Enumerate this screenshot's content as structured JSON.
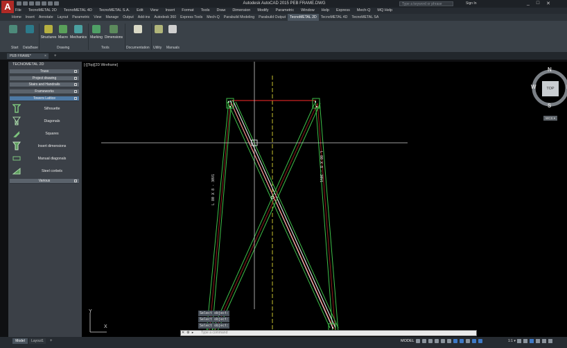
{
  "window": {
    "title": "Autodesk AutoCAD 2015    PEB FRAME.DWG",
    "search_placeholder": "Type a keyword or phrase",
    "sign_in": "Sign In",
    "controls": [
      "_",
      "□",
      "✕"
    ]
  },
  "menu": [
    "File",
    "TecnoMETAL 2D",
    "TecnoMETAL 4D",
    "TecnoMETAL S.A.",
    "Edit",
    "View",
    "Insert",
    "Format",
    "Tools",
    "Draw",
    "Dimension",
    "Modify",
    "Parametric",
    "Window",
    "Help",
    "Express",
    "Mech-Q",
    "MQ Help"
  ],
  "ribbon_tabs": [
    "Home",
    "Insert",
    "Annotate",
    "Layout",
    "Parametric",
    "View",
    "Manage",
    "Output",
    "Add-ins",
    "Autodesk 360",
    "Express Tools",
    "Mech-Q",
    "Parabuild Modeling",
    "Parabuild Output",
    "TecnoMETAL 2D",
    "TecnoMETAL 4D",
    "TecnoMETAL SA"
  ],
  "ribbon_active_tab": "TecnoMETAL 2D",
  "ribbon": {
    "buttons": [
      "Structures",
      "Macro",
      "Mechanics",
      "Marking",
      "Dimensions",
      "Utility"
    ],
    "groups": [
      "Start",
      "DataBase",
      "Drawing",
      "Tools",
      "Documentation",
      "Utility",
      "Manuals"
    ]
  },
  "file_tab": {
    "label": "PEB FRAME*",
    "close": "×",
    "new": "+"
  },
  "palette": {
    "title": "TECNOMETAL 2D",
    "categories": [
      "Truss",
      "Project drawing",
      "Stairs and Handrails",
      "Frameworks",
      "Towers Lattice"
    ],
    "items": [
      "Silhouette",
      "Diagonals",
      "Squares",
      "Insert dimensions",
      "Manual diagonals",
      "Steel corbels"
    ],
    "bottom_category": "Various"
  },
  "viewport": {
    "label": "[-][Top][2D Wireframe]",
    "member_label_left": "L 80 X 8 - 30V1",
    "member_label_right": "L 80 X 8 - 30V1"
  },
  "viewcube": {
    "top": "TOP",
    "n": "N",
    "s": "S",
    "w": "W",
    "e": "E",
    "wcs": "WCS ▾"
  },
  "ucs": {
    "y": "Y",
    "x": "X"
  },
  "command": {
    "history": [
      "Select object:",
      "Select object:",
      "Select object:"
    ],
    "placeholder": "Type a command"
  },
  "status": {
    "tabs": [
      "Model",
      "Layout1"
    ],
    "add_tab": "+",
    "model": "MODEL",
    "scale": "1:1 ▾"
  },
  "colors": {
    "green": "#3ec04a",
    "red": "#ff2b2b",
    "yellow": "#c8c230",
    "accent": "#4d79a4"
  }
}
